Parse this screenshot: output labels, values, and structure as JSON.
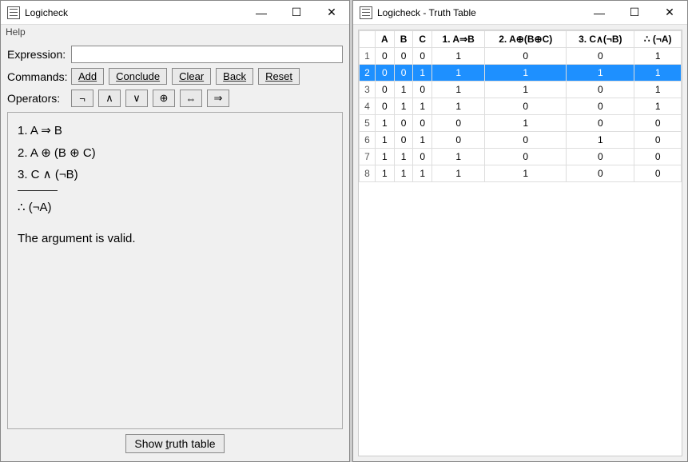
{
  "left": {
    "title": "Logicheck",
    "menu": {
      "help": "Help"
    },
    "labels": {
      "expression": "Expression:",
      "commands": "Commands:",
      "operators": "Operators:"
    },
    "expression_value": "",
    "commands": {
      "add": "Add",
      "conclude": "Conclude",
      "clear": "Clear",
      "back": "Back",
      "reset": "Reset"
    },
    "operators": {
      "not": "¬",
      "and": "∧",
      "or": "∨",
      "xor": "⊕",
      "iff": "⇔",
      "imp": "⇒"
    },
    "premises": [
      "1. A ⇒ B",
      "2. A ⊕ (B ⊕ C)",
      "3. C ∧ (¬B)"
    ],
    "conclusion": "∴ (¬A)",
    "verdict": "The argument is valid.",
    "show_truth_prefix": "Show ",
    "show_truth_underlined": "t",
    "show_truth_suffix": "ruth table"
  },
  "right": {
    "title": "Logicheck - Truth Table",
    "headers": [
      "",
      "A",
      "B",
      "C",
      "1.  A⇒B",
      "2.  A⊕(B⊕C)",
      "3.  C∧(¬B)",
      "∴  (¬A)"
    ],
    "rows": [
      {
        "n": "1",
        "v": [
          "0",
          "0",
          "0",
          "1",
          "0",
          "0",
          "1"
        ]
      },
      {
        "n": "2",
        "v": [
          "0",
          "0",
          "1",
          "1",
          "1",
          "1",
          "1"
        ],
        "selected": true
      },
      {
        "n": "3",
        "v": [
          "0",
          "1",
          "0",
          "1",
          "1",
          "0",
          "1"
        ]
      },
      {
        "n": "4",
        "v": [
          "0",
          "1",
          "1",
          "1",
          "0",
          "0",
          "1"
        ]
      },
      {
        "n": "5",
        "v": [
          "1",
          "0",
          "0",
          "0",
          "1",
          "0",
          "0"
        ]
      },
      {
        "n": "6",
        "v": [
          "1",
          "0",
          "1",
          "0",
          "0",
          "1",
          "0"
        ]
      },
      {
        "n": "7",
        "v": [
          "1",
          "1",
          "0",
          "1",
          "0",
          "0",
          "0"
        ]
      },
      {
        "n": "8",
        "v": [
          "1",
          "1",
          "1",
          "1",
          "1",
          "0",
          "0"
        ]
      }
    ]
  }
}
